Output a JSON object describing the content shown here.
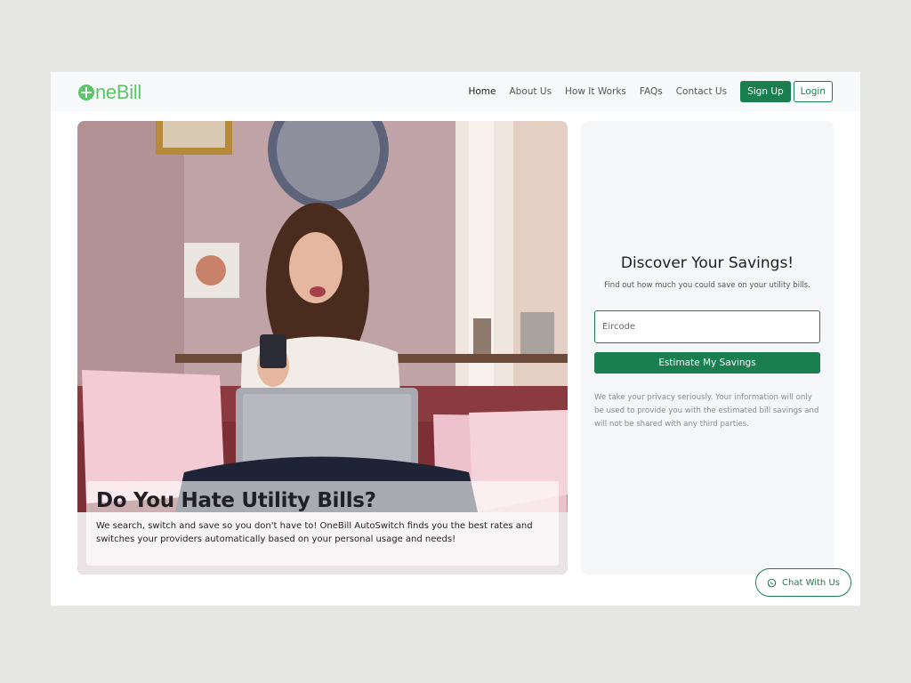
{
  "brand": {
    "logo_text": "neBill"
  },
  "nav": {
    "links": [
      "Home",
      "About Us",
      "How It Works",
      "FAQs",
      "Contact Us"
    ],
    "active": "Home",
    "signup_label": "Sign Up",
    "login_label": "Login"
  },
  "hero": {
    "title": "Do You Hate Utility Bills?",
    "text": "We search, switch and save so you don't have to! OneBill AutoSwitch finds you the best rates and switches your providers automatically based on your personal usage and needs!"
  },
  "savings": {
    "title": "Discover Your Savings!",
    "subtitle": "Find out how much you could save on your utility bills.",
    "eircode_placeholder": "Eircode",
    "button_label": "Estimate My Savings",
    "privacy_text": "We take your privacy seriously. Your information will only be used to provide you with the estimated bill savings and will not be shared with any third parties."
  },
  "chat": {
    "label": "Chat With Us",
    "icon": "whatsapp-icon"
  },
  "colors": {
    "primary": "#1a7f4f",
    "logo": "#5cc56a",
    "background": "#e6e7e2",
    "card": "#f5f6f8"
  }
}
